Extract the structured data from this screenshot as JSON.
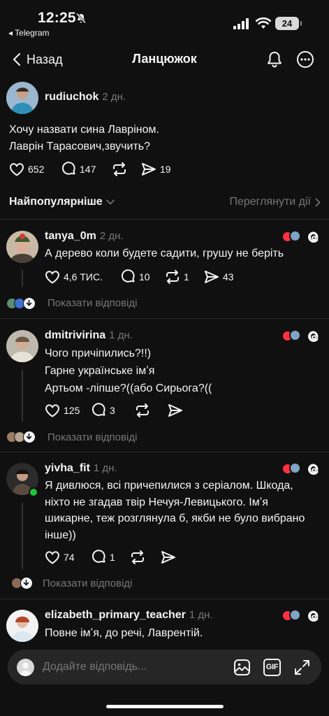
{
  "status_bar": {
    "time": "12:25",
    "back_app": "◂ Telegram",
    "battery": "24"
  },
  "header": {
    "back_label": "Назад",
    "title": "Ланцюжок"
  },
  "post": {
    "username": "rudiuchok",
    "ago": "2 дн.",
    "lines": [
      "Хочу назвати сина Лавріном.",
      "Лаврін Тарасович,звучить?"
    ],
    "likes": "652",
    "comments": "147",
    "shares": "19"
  },
  "sort": {
    "label": "Найпопулярніше",
    "activity_label": "Переглянути дії"
  },
  "replies": [
    {
      "username": "tanya_0m",
      "ago": "2 дн.",
      "lines": [
        "А дерево коли будете садити, грушу не беріть"
      ],
      "likes": "4,6 ТИС.",
      "comments": "10",
      "reposts": "1",
      "shares": "43",
      "show_replies": "Показати відповіді"
    },
    {
      "username": "dmitrivirina",
      "ago": "1 дн.",
      "lines": [
        "Чого причіпились?!!)",
        "Гарне українське імʼя",
        "Артьом -ліпше?((або Сирьога?(("
      ],
      "likes": "125",
      "comments": "3",
      "reposts": "",
      "shares": "",
      "show_replies": "Показати відповіді"
    },
    {
      "username": "yivha_fit",
      "ago": "1 дн.",
      "lines": [
        "Я дивлюся, всі причепилися з серіалом. Шкода,",
        "ніхто не згадав твір Нечуя-Левицького. Імʼя",
        "шикарне, теж розглянула б, якби не було вибрано",
        "інше))"
      ],
      "likes": "74",
      "comments": "1",
      "reposts": "",
      "shares": "",
      "show_replies": "Показати відповіді"
    },
    {
      "username": "elizabeth_primary_teacher",
      "ago": "1 дн.",
      "lines": [
        "Повне імʼя, до речі, Лаврентій."
      ]
    }
  ],
  "composer": {
    "placeholder": "Додайте відповідь..."
  },
  "colors": {
    "background": "#101010",
    "text": "#f3f5f7",
    "muted": "#777777",
    "like_red": "#ff3040",
    "online_green": "#1ec43a"
  },
  "icons": [
    "bell-icon",
    "more-icon",
    "heart-icon",
    "comment-icon",
    "repost-icon",
    "share-icon",
    "threads-icon",
    "image-icon",
    "gif-icon",
    "expand-icon"
  ]
}
